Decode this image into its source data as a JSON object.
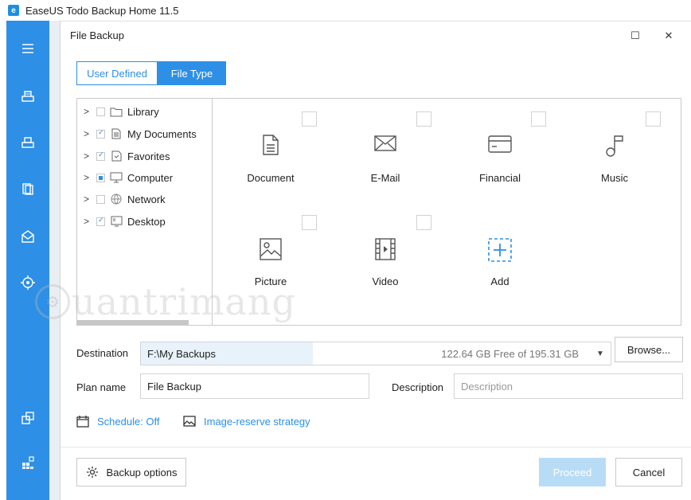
{
  "app": {
    "logo": "e",
    "title": "EaseUS Todo Backup Home 11.5"
  },
  "sidebar": {
    "icons": [
      "menu-icon",
      "disk-backup-icon",
      "system-backup-icon",
      "file-backup-icon",
      "mail-backup-icon",
      "smart-backup-icon",
      "clone-icon",
      "tools-icon"
    ]
  },
  "dialog": {
    "title": "File Backup",
    "maximize_glyph": "☐",
    "close_glyph": "✕",
    "tabs": [
      "User Defined",
      "File Type"
    ],
    "active_tab": "File Type",
    "tree": [
      {
        "label": "Library",
        "state": "unchecked",
        "icon": "folder-icon"
      },
      {
        "label": "My Documents",
        "state": "checked",
        "icon": "document-icon"
      },
      {
        "label": "Favorites",
        "state": "checked",
        "icon": "favorites-icon"
      },
      {
        "label": "Computer",
        "state": "partial",
        "icon": "computer-icon"
      },
      {
        "label": "Network",
        "state": "unchecked",
        "icon": "network-icon"
      },
      {
        "label": "Desktop",
        "state": "checked",
        "icon": "desktop-icon"
      }
    ],
    "file_types": [
      {
        "label": "Document",
        "icon": "document-type-icon"
      },
      {
        "label": "E-Mail",
        "icon": "email-icon"
      },
      {
        "label": "Financial",
        "icon": "financial-icon"
      },
      {
        "label": "Music",
        "icon": "music-icon"
      },
      {
        "label": "Picture",
        "icon": "picture-icon"
      },
      {
        "label": "Video",
        "icon": "video-icon"
      },
      {
        "label": "Add",
        "icon": "add-icon"
      }
    ],
    "destination": {
      "label": "Destination",
      "path": "F:\\My Backups",
      "free": "122.64 GB Free of 195.31 GB",
      "dropdown_glyph": "▼",
      "browse": "Browse..."
    },
    "plan_name": {
      "label": "Plan name",
      "value": "File Backup"
    },
    "description": {
      "label": "Description",
      "placeholder": "Description"
    },
    "schedule": "Schedule: Off",
    "image_reserve": "Image-reserve strategy",
    "backup_options": "Backup options",
    "proceed": "Proceed",
    "cancel": "Cancel"
  },
  "watermark": "uantrimang",
  "colors": {
    "accent": "#2d8fe6",
    "proceed_disabled": "#b9dcf6"
  }
}
